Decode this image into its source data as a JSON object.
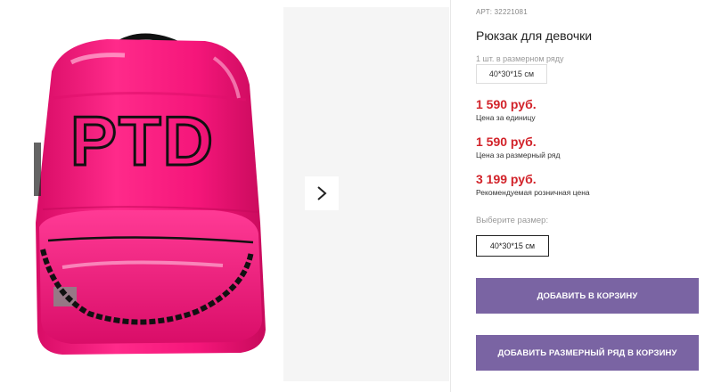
{
  "product": {
    "article": "АРТ: 32221081",
    "title": "Рюкзак для девочки",
    "pack_note": "1 шт. в размерном ряду",
    "pack_size": "40*30*15 см",
    "logo_text": "PTD"
  },
  "prices": [
    {
      "value": "1 590 руб.",
      "note": "Цена за единицу"
    },
    {
      "value": "1 590 руб.",
      "note": "Цена за размерный ряд"
    },
    {
      "value": "3 199 руб.",
      "note": "Рекомендуемая розничная цена"
    }
  ],
  "size_selector": {
    "label": "Выберите размер:",
    "option": "40*30*15 см"
  },
  "buttons": {
    "add_to_cart": "ДОБАВИТЬ В КОРЗИНУ",
    "add_size_row": "ДОБАВИТЬ РАЗМЕРНЫЙ РЯД В КОРЗИНУ"
  },
  "colors": {
    "price": "#d2232a",
    "button": "#7a64a3",
    "backpack": "#f2167a"
  },
  "icons": {
    "gallery_next": "chevron-right-icon"
  }
}
